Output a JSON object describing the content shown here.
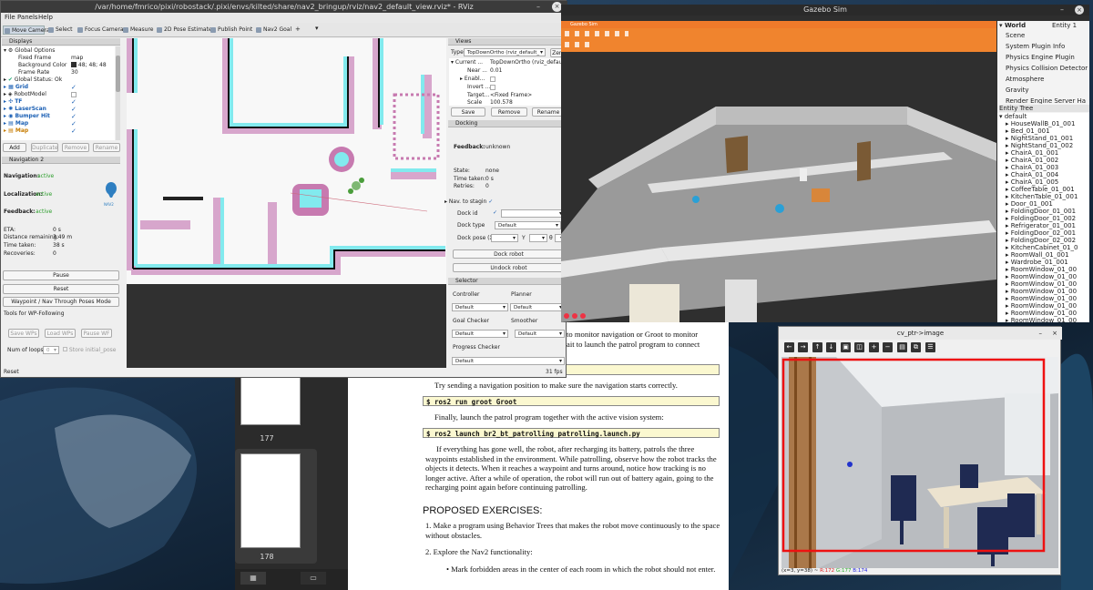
{
  "rviz": {
    "title": "/var/home/fmrico/pixi/robostack/.pixi/envs/kilted/share/nav2_bringup/rviz/nav2_default_view.rviz* - RViz",
    "menu": [
      "File",
      "Panels",
      "Help"
    ],
    "tools": [
      "Move Camera",
      "Select",
      "Focus Camera",
      "Measure",
      "2D Pose Estimate",
      "Publish Point",
      "Nav2 Goal"
    ],
    "displays": {
      "title": "Displays",
      "items": [
        {
          "label": "Global Options",
          "value": ""
        },
        {
          "label": "Fixed Frame",
          "value": "map"
        },
        {
          "label": "Background Color",
          "value": "48; 48; 48"
        },
        {
          "label": "Frame Rate",
          "value": "30"
        },
        {
          "label": "Global Status: Ok",
          "value": ""
        },
        {
          "label": "Grid",
          "value": "✓"
        },
        {
          "label": "RobotModel",
          "value": ""
        },
        {
          "label": "TF",
          "value": "✓"
        },
        {
          "label": "LaserScan",
          "value": "✓"
        },
        {
          "label": "Bumper Hit",
          "value": "✓"
        },
        {
          "label": "Map",
          "value": "✓"
        },
        {
          "label": "Map",
          "value": "✓"
        }
      ],
      "buttons": [
        "Add",
        "Duplicate",
        "Remove",
        "Rename"
      ]
    },
    "nav2": {
      "title": "Navigation 2",
      "navigation_label": "Navigation:",
      "navigation_value": "active",
      "localization_label": "Localization:",
      "localization_value": "active",
      "feedback_label": "Feedback:",
      "feedback_value": "active",
      "logo_text": "NAV2",
      "eta_label": "ETA:",
      "eta_value": "0 s",
      "dist_label": "Distance remaining:",
      "dist_value": "3.49 m",
      "time_label": "Time taken:",
      "time_value": "38 s",
      "rec_label": "Recoveries:",
      "rec_value": "0",
      "pause": "Pause",
      "reset": "Reset",
      "waypoint": "Waypoint / Nav Through Poses Mode",
      "wp_title": "Tools for WP-Following",
      "wp_buttons": [
        "Save WPs",
        "Load WPs",
        "Pause WF"
      ],
      "loops_label": "Num of loops",
      "loops_value": "0",
      "store_label": "Store initial_pose"
    },
    "reset_bottom": "Reset",
    "fps": "31 fps",
    "views": {
      "title": "Views",
      "type_label": "Type:",
      "type_value": "TopDownOrtho (rviz_default_",
      "zero": "Zero",
      "rows": [
        {
          "k": "Current ...",
          "v": "TopDownOrtho (rviz_default"
        },
        {
          "k": "Near ...",
          "v": "0.01"
        },
        {
          "k": "Enabl...",
          "v": ""
        },
        {
          "k": "Invert ...",
          "v": ""
        },
        {
          "k": "Target...",
          "v": "<Fixed Frame>"
        },
        {
          "k": "Scale",
          "v": "100.578"
        }
      ],
      "buttons": [
        "Save",
        "Remove",
        "Rename"
      ]
    },
    "docking": {
      "title": "Docking",
      "feedback_label": "Feedback:",
      "feedback_value": "unknown",
      "state_label": "State:",
      "state_value": "none",
      "time_label": "Time taken:",
      "time_value": "0 s",
      "retries_label": "Retries:",
      "retries_value": "0",
      "nav_label": "Nav. to stagin",
      "dockid_label": "Dock id",
      "docktype_label": "Dock type",
      "docktype_value": "Default",
      "dockpose_label": "Dock pose (X",
      "y_label": "Y",
      "theta_label": "θ",
      "dock_btn": "Dock robot",
      "undock_btn": "Undock robot"
    },
    "selector": {
      "title": "Selector",
      "controller_label": "Controller",
      "controller_value": "Default",
      "planner_label": "Planner",
      "planner_value": "Default",
      "goal_label": "Goal Checker",
      "goal_value": "Default",
      "smoother_label": "Smoother",
      "smoother_value": "Default",
      "progress_label": "Progress Checker",
      "progress_value": "Default"
    }
  },
  "gazebo": {
    "title": "Gazebo Sim",
    "inner_title": "Gazebo Sim",
    "world_label": "World",
    "entity_header": "Entity 1",
    "world_items": [
      "Scene",
      "System Plugin Info",
      "Physics Engine Plugin",
      "Physics Collision Detector",
      "Atmosphere",
      "Gravity",
      "Render Engine Server Ha"
    ],
    "tree_title": "Entity Tree",
    "entities": [
      "default",
      "HouseWallB_01_001",
      "Bed_01_001",
      "NightStand_01_001",
      "NightStand_01_002",
      "ChairA_01_001",
      "ChairA_01_002",
      "ChairA_01_003",
      "ChairA_01_004",
      "ChairA_01_005",
      "CoffeeTable_01_001",
      "KitchenTable_01_001",
      "Door_01_001",
      "FoldingDoor_01_001",
      "FoldingDoor_01_002",
      "Refrigerator_01_001",
      "FoldingDoor_02_001",
      "FoldingDoor_02_002",
      "KitchenCabinet_01_0",
      "RoomWall_01_001",
      "Wardrobe_01_001",
      "RoomWindow_01_00",
      "RoomWindow_01_00",
      "RoomWindow_01_00",
      "RoomWindow_01_00",
      "RoomWindow_01_00",
      "RoomWindow_01_00",
      "RoomWindow_01_00",
      "RoomWindow_01_00"
    ]
  },
  "pdf": {
    "line1": "to monitor navigation or Groot to monitor",
    "line2": "ait to launch the patrol program to connect",
    "try_text": "Try sending a navigation position to make sure the navigation starts correctly.",
    "cmd_groot": "$ ros2 run groot Groot",
    "finally_text": "Finally, launch the patrol program together with the active vision system:",
    "cmd_launch": "$ ros2 launch br2_bt_patrolling patrolling.launch.py",
    "para": "If everything has gone well, the robot, after recharging its battery, patrols the three waypoints established in the environment. While patrolling, observe how the robot tracks the objects it detects. When it reaches a waypoint and turns around, notice how tracking is no longer active. After a while of operation, the robot will run out of battery again, going to the recharging point again before continuing patrolling.",
    "exercises_title": "PROPOSED EXERCISES:",
    "ex1": "1. Make a program using Behavior Trees that makes the robot move continuously to the space without obstacles.",
    "ex2": "2. Explore the Nav2 functionality:",
    "ex2a": "• Mark forbidden areas in the center of each room in which the robot should not enter.",
    "page_177": "177",
    "page_178": "178"
  },
  "cv": {
    "title": "cv_ptr->image",
    "status_coords": "(x=3, y=38) ~",
    "r": "R:172",
    "g": "G:177",
    "b": "B:174"
  }
}
